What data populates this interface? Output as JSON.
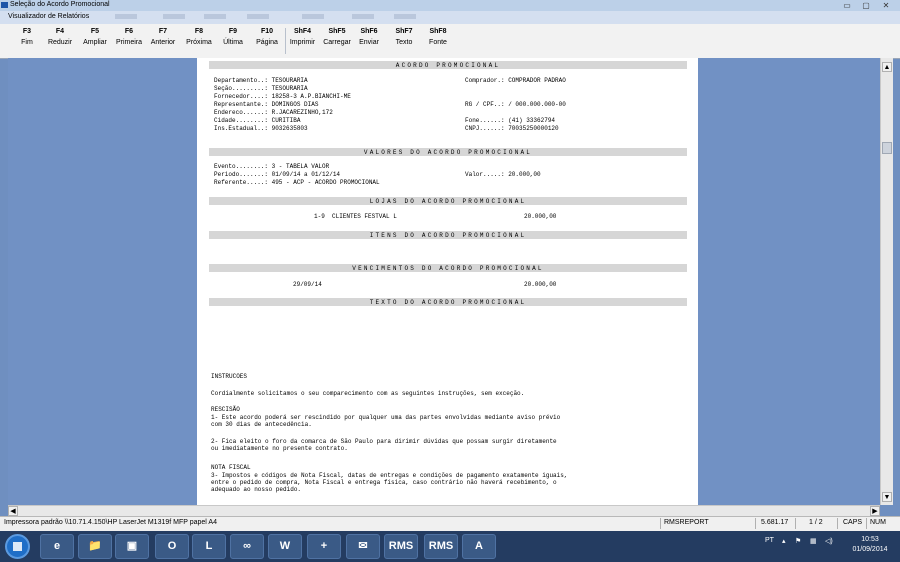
{
  "window": {
    "title": "Seleção do Acordo Promocional",
    "controls": [
      "▭",
      "▢",
      "✕"
    ]
  },
  "viewer": {
    "title": "Visualizador de Relatórios"
  },
  "toolbar": {
    "buttons": [
      {
        "key": "F3",
        "label": "Fim"
      },
      {
        "key": "F4",
        "label": "Reduzir"
      },
      {
        "key": "F5",
        "label": "Ampliar"
      },
      {
        "key": "F6",
        "label": "Primeira"
      },
      {
        "key": "F7",
        "label": "Anterior"
      },
      {
        "key": "F8",
        "label": "Próxima"
      },
      {
        "key": "F9",
        "label": "Última"
      },
      {
        "key": "F10",
        "label": "Página"
      },
      {
        "key": "ShF4",
        "label": "Imprimir"
      },
      {
        "key": "ShF5",
        "label": "Carregar"
      },
      {
        "key": "ShF6",
        "label": "Enviar"
      },
      {
        "key": "ShF7",
        "label": "Texto"
      },
      {
        "key": "ShF8",
        "label": "Fonte"
      }
    ]
  },
  "report": {
    "header_band": "ACORDO PROMOCIONAL",
    "left_fields": [
      "Departamento..: TESOURARIA",
      "Seção.........: TESOURARIA",
      "Fornecedor....: 18258-3 A.P.BIANCHI-ME",
      "Representante.: DOMINGOS DIAS",
      "Endereco......: R.JACAREZINHO,172",
      "Cidade........: CURITIBA",
      "Ins.Estadual..: 9032635803"
    ],
    "right_fields": [
      "Comprador.: COMPRADOR PADRAO",
      "",
      "",
      "RG / CPF..: / 000.000.000-00",
      "",
      "Fone......: (41) 33362794",
      "CNPJ......: 70035250000120"
    ],
    "valores_band": "VALORES DO ACORDO PROMOCIONAL",
    "evento": "Evento........: 3 - TABELA VALOR",
    "periodo": "Periodo.......: 01/09/14 a 01/12/14",
    "valor": "Valor.....: 20.000,00",
    "referente": "Referente.....: 495 - ACP - ACORDO PROMOCIONAL",
    "lojas_band": "LOJAS DO ACORDO PROMOCIONAL",
    "loja_line": "1-9  CLIENTES FESTVAL L",
    "loja_valor": "20.000,00",
    "itens_band": "ITENS DO ACORDO PROMOCIONAL",
    "vencimentos_band": "VENCIMENTOS DO ACORDO PROMOCIONAL",
    "vencimento_data": "29/09/14",
    "vencimento_valor": "20.000,00",
    "texto_band": "TEXTO DO ACORDO PROMOCIONAL",
    "instrucoes_title": "INSTRUCOES",
    "instrucoes_intro": "Cordialmente solicitamos o seu comparecimento com as seguintes instruções, sem exceção.",
    "rescisao_title": "RESCISÃO",
    "rescisao_1": "1- Este acordo poderá ser rescindido por qualquer uma das partes envolvidas mediante aviso prévio\ncom 30 dias de antecedência.",
    "rescisao_2": "2- Fica eleito o foro da comarca de São Paulo para dirimir dúvidas que possam surgir diretamente\nou imediatamente no presente contrato.",
    "nota_title": "NOTA FISCAL",
    "nota_3": "3- Impostos e códigos de Nota Fiscal, datas de entregas e condições de pagamento exatamente iguais,\nentre o pedido de compra, Nota Fiscal e entrega física, caso contrário não haverá recebimento, o\nadequado ao nosso pedido."
  },
  "status": {
    "printer": "Impressora padrão \\\\10.71.4.150\\HP LaserJet M1319f MFP papel A4",
    "report_name": "RMSREPORT",
    "value": "5.681.17",
    "page": "1 / 2",
    "caps": "CAPS",
    "num": "NUM"
  },
  "taskbar": {
    "apps": [
      "e",
      "📁",
      "▣",
      "O",
      "L",
      "∞",
      "W",
      "+",
      "✉",
      "RMS",
      "RMS",
      "A"
    ],
    "lang": "PT",
    "time": "10:53",
    "date": "01/09/2014"
  }
}
